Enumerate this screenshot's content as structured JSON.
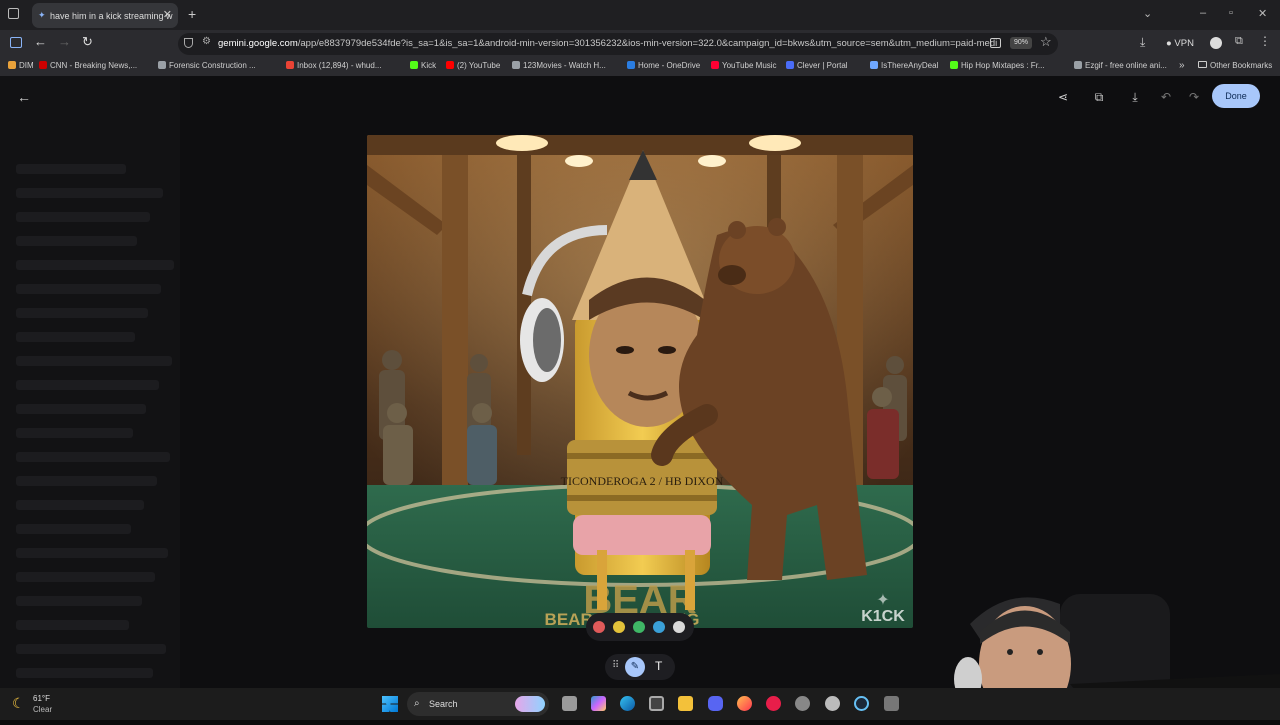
{
  "browser": {
    "tab_title": "have him in a kick streaming w",
    "url_domain": "gemini.google.com",
    "url_rest": "/app/e8837979de534fde?is_sa=1&is_sa=1&android-min-version=301356232&ios-min-version=322.0&campaign_id=bkws&utm_source=sem&utm_medium=paid-medi",
    "zoom": "90%",
    "vpn_label": "VPN"
  },
  "bookmarks": [
    {
      "label": "DIM",
      "color": "#e9a23b"
    },
    {
      "label": "CNN - Breaking News,...",
      "color": "#cc0000"
    },
    {
      "label": "Forensic Construction ...",
      "color": "#9aa0a6"
    },
    {
      "label": "Inbox (12,894) - whud...",
      "color": "#ea4335"
    },
    {
      "label": "Kick",
      "color": "#53fc18"
    },
    {
      "label": "(2) YouTube",
      "color": "#ff0000"
    },
    {
      "label": "123Movies - Watch H...",
      "color": "#9aa0a6"
    },
    {
      "label": "Home - OneDrive",
      "color": "#2a7de1"
    },
    {
      "label": "YouTube Music",
      "color": "#ff0033"
    },
    {
      "label": "Clever | Portal",
      "color": "#4a6cf7"
    },
    {
      "label": "IsThereAnyDeal",
      "color": "#6fa7ff"
    },
    {
      "label": "Hip Hop Mixtapes : Fr...",
      "color": "#53fc18"
    },
    {
      "label": "Ezgif - free online ani...",
      "color": "#9aa0a6"
    }
  ],
  "other_bookmarks": "Other Bookmarks",
  "editor": {
    "done_label": "Done",
    "text_tool": "T"
  },
  "artwork": {
    "pencil_text": "TICONDEROGA 2 / HB  DIXON",
    "mat_text_big": "BEAR",
    "mat_text_small": "BEAR WRESTLING",
    "watermark": "K1CK"
  },
  "palette_colors": [
    "#e05a5a",
    "#e3c23a",
    "#3fb766",
    "#3aa0d8",
    "#d9d9d9"
  ],
  "weather": {
    "temp": "61°F",
    "condition": "Clear"
  },
  "taskbar": {
    "search_placeholder": "Search"
  }
}
